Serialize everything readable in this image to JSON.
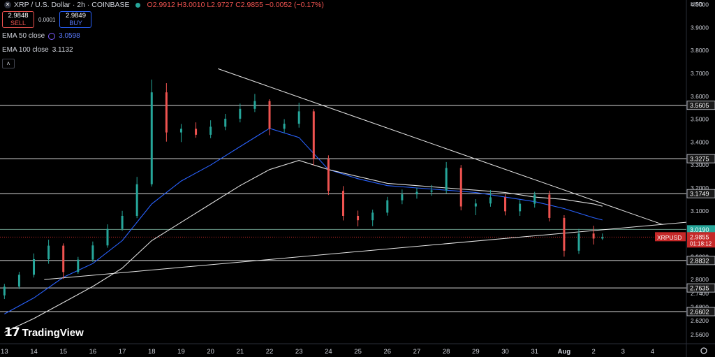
{
  "header": {
    "symbol_icon": "x-logo-icon",
    "title": "XRP / U.S. Dollar · 2h · COINBASE",
    "ohlc": "O2.9912 H3.0010 L2.9727 C2.9855 −0.0052 (−0.17%)"
  },
  "trade": {
    "sell_price": "2.9848",
    "sell_label": "SELL",
    "spread": "0.0001",
    "buy_price": "2.9849",
    "buy_label": "BUY"
  },
  "indicators": [
    {
      "label": "EMA 50 close",
      "value": "3.0598",
      "color": "#2962ff"
    },
    {
      "label": "EMA 100 close",
      "value": "3.1132",
      "color": "#e0e0e0"
    }
  ],
  "collapse_label": "˄",
  "logo_text": "TradingView",
  "axis_currency": "USD",
  "settings_icon": "gear-icon",
  "colors": {
    "up": "#26a69a",
    "down": "#ef5350",
    "ema50": "#2962ff",
    "ema100": "#e0e0e0",
    "hline": "#ffffff",
    "price_tag": "#c62828",
    "support_tag": "#26a69a"
  },
  "chart_data": {
    "type": "candlestick",
    "ylim": [
      2.52,
      4.02
    ],
    "y_ticks": [
      "4.0000",
      "3.9000",
      "3.8000",
      "3.7000",
      "3.6000",
      "3.5000",
      "3.4000",
      "3.3000",
      "3.2000",
      "3.1000",
      "3.0000",
      "2.9000",
      "2.8000",
      "2.7400",
      "2.6800",
      "2.6200",
      "2.5600"
    ],
    "x_ticks": [
      "13",
      "14",
      "15",
      "16",
      "17",
      "18",
      "19",
      "20",
      "21",
      "22",
      "23",
      "24",
      "25",
      "26",
      "27",
      "28",
      "29",
      "30",
      "31",
      "Aug",
      "2",
      "3",
      "4"
    ],
    "x_tick_days": [
      0,
      1,
      2,
      3,
      4,
      5,
      6,
      7,
      8,
      9,
      10,
      11,
      12,
      13,
      14,
      15,
      16,
      17,
      18,
      19,
      20,
      21,
      22
    ],
    "x_range_days": [
      -0.15,
      23.15
    ],
    "horizontal_levels": [
      {
        "value": 3.5605,
        "label": "3.5605"
      },
      {
        "value": 3.3275,
        "label": "3.3275"
      },
      {
        "value": 3.1749,
        "label": "3.1749"
      },
      {
        "value": 3.019,
        "label": "3.0190",
        "style": "support"
      },
      {
        "value": 2.8832,
        "label": "2.8832"
      },
      {
        "value": 2.7635,
        "label": "2.7635"
      },
      {
        "value": 2.6602,
        "label": "2.6602"
      }
    ],
    "current_price": {
      "symbol": "XRPUSD",
      "value": "2.9855",
      "countdown": "01:18:12",
      "level": 2.9855
    },
    "trendlines": [
      {
        "from": [
          7.25,
          3.72
        ],
        "to": [
          22.35,
          3.04
        ]
      },
      {
        "from": [
          1.35,
          2.8
        ],
        "to": [
          23.15,
          3.05
        ]
      }
    ],
    "series": [
      {
        "name": "EMA 50 close",
        "color": "#2962ff",
        "points": [
          [
            0,
            2.65
          ],
          [
            1,
            2.72
          ],
          [
            2,
            2.81
          ],
          [
            3,
            2.87
          ],
          [
            4,
            2.97
          ],
          [
            5,
            3.13
          ],
          [
            6,
            3.23
          ],
          [
            7,
            3.3
          ],
          [
            8,
            3.38
          ],
          [
            9,
            3.46
          ],
          [
            10,
            3.42
          ],
          [
            11,
            3.28
          ],
          [
            12,
            3.24
          ],
          [
            13,
            3.21
          ],
          [
            14,
            3.2
          ],
          [
            15,
            3.19
          ],
          [
            16,
            3.18
          ],
          [
            17,
            3.16
          ],
          [
            18,
            3.14
          ],
          [
            19,
            3.11
          ],
          [
            20,
            3.07
          ],
          [
            20.3,
            3.06
          ]
        ]
      },
      {
        "name": "EMA 100 close",
        "color": "#e0e0e0",
        "points": [
          [
            0,
            2.57
          ],
          [
            1,
            2.63
          ],
          [
            2,
            2.7
          ],
          [
            3,
            2.77
          ],
          [
            4,
            2.85
          ],
          [
            5,
            2.97
          ],
          [
            6,
            3.05
          ],
          [
            7,
            3.13
          ],
          [
            8,
            3.21
          ],
          [
            9,
            3.28
          ],
          [
            10,
            3.32
          ],
          [
            11,
            3.28
          ],
          [
            12,
            3.25
          ],
          [
            13,
            3.22
          ],
          [
            14,
            3.21
          ],
          [
            15,
            3.2
          ],
          [
            16,
            3.19
          ],
          [
            17,
            3.18
          ],
          [
            18,
            3.16
          ],
          [
            19,
            3.15
          ],
          [
            20,
            3.13
          ],
          [
            20.3,
            3.12
          ]
        ]
      }
    ],
    "candles": [
      [
        0.0,
        2.731,
        2.781,
        2.715,
        2.769
      ],
      [
        0.5,
        2.769,
        2.834,
        2.759,
        2.821
      ],
      [
        1.0,
        2.821,
        2.914,
        2.809,
        2.889
      ],
      [
        1.5,
        2.889,
        2.974,
        2.869,
        2.948
      ],
      [
        2.0,
        2.948,
        2.958,
        2.803,
        2.833
      ],
      [
        2.5,
        2.833,
        2.899,
        2.825,
        2.887
      ],
      [
        3.0,
        2.887,
        2.966,
        2.877,
        2.949
      ],
      [
        3.5,
        2.949,
        3.041,
        2.939,
        3.021
      ],
      [
        4.0,
        3.021,
        3.1,
        3.013,
        3.078
      ],
      [
        4.5,
        3.078,
        3.248,
        3.068,
        3.216
      ],
      [
        5.0,
        3.216,
        3.673,
        3.206,
        3.617
      ],
      [
        5.5,
        3.617,
        3.657,
        3.402,
        3.442
      ],
      [
        6.0,
        3.442,
        3.479,
        3.4,
        3.458
      ],
      [
        6.5,
        3.458,
        3.486,
        3.419,
        3.432
      ],
      [
        7.0,
        3.432,
        3.495,
        3.417,
        3.467
      ],
      [
        7.5,
        3.467,
        3.523,
        3.452,
        3.502
      ],
      [
        8.0,
        3.502,
        3.568,
        3.486,
        3.545
      ],
      [
        8.5,
        3.545,
        3.61,
        3.531,
        3.579
      ],
      [
        9.0,
        3.579,
        3.587,
        3.43,
        3.458
      ],
      [
        9.5,
        3.458,
        3.5,
        3.441,
        3.48
      ],
      [
        10.0,
        3.48,
        3.572,
        3.463,
        3.534
      ],
      [
        10.5,
        3.534,
        3.544,
        3.298,
        3.326
      ],
      [
        11.0,
        3.326,
        3.342,
        3.169,
        3.187
      ],
      [
        11.5,
        3.187,
        3.208,
        3.058,
        3.078
      ],
      [
        12.0,
        3.078,
        3.101,
        3.032,
        3.059
      ],
      [
        12.5,
        3.059,
        3.105,
        3.033,
        3.092
      ],
      [
        13.0,
        3.092,
        3.161,
        3.079,
        3.146
      ],
      [
        13.5,
        3.146,
        3.193,
        3.129,
        3.172
      ],
      [
        14.0,
        3.172,
        3.201,
        3.153,
        3.183
      ],
      [
        14.5,
        3.183,
        3.213,
        3.166,
        3.189
      ],
      [
        15.0,
        3.189,
        3.313,
        3.176,
        3.287
      ],
      [
        15.5,
        3.287,
        3.3,
        3.102,
        3.119
      ],
      [
        16.0,
        3.119,
        3.151,
        3.081,
        3.132
      ],
      [
        16.5,
        3.132,
        3.191,
        3.118,
        3.159
      ],
      [
        17.0,
        3.159,
        3.172,
        3.08,
        3.098
      ],
      [
        17.5,
        3.098,
        3.147,
        3.078,
        3.131
      ],
      [
        18.0,
        3.131,
        3.183,
        3.114,
        3.171
      ],
      [
        18.5,
        3.171,
        3.188,
        3.054,
        3.069
      ],
      [
        19.0,
        3.069,
        3.081,
        2.9,
        2.926
      ],
      [
        19.5,
        2.926,
        3.021,
        2.912,
        3.001
      ],
      [
        20.0,
        3.001,
        3.035,
        2.953,
        2.979
      ],
      [
        20.3,
        2.979,
        3.001,
        2.973,
        2.9855
      ]
    ]
  }
}
